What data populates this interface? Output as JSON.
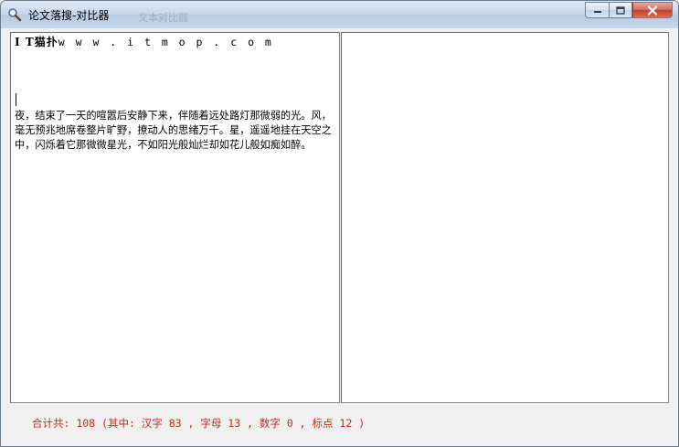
{
  "window": {
    "title": "论文落搜-对比器",
    "ghost_title": "文本对比器"
  },
  "editor_left": {
    "first_line_bold": "I T",
    "first_line_cn": "猫扑",
    "first_line_mono": "w w w . i t m o p . c o m",
    "paragraph": "夜，结束了一天的喧嚣后安静下来，伴随着远处路灯那微弱的光。风，毫无预兆地席卷整片旷野，撩动人的思绪万千。星，遥遥地挂在天空之中，闪烁着它那微微星光，不如阳光般灿烂却如花儿般如痴如醉。"
  },
  "editor_right": {
    "content": ""
  },
  "status": {
    "text": "合计共: 108 (其中: 汉字 83 , 字母 13 , 数字 0 , 标点 12 )",
    "color": "#c8281e"
  },
  "icons": {
    "app": "magnifier-icon",
    "minimize": "minimize-icon",
    "maximize": "maximize-icon",
    "close": "close-icon"
  }
}
